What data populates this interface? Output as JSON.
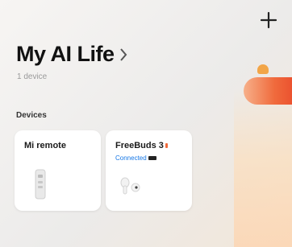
{
  "header": {
    "title": "My AI Life",
    "subtitle": "1 device",
    "add_icon": "plus-icon",
    "chevron_icon": "chevron-right-icon"
  },
  "devices": {
    "section_label": "Devices",
    "items": [
      {
        "name": "Mi remote",
        "status": "",
        "icon": "remote-icon"
      },
      {
        "name": "FreeBuds 3",
        "status": "Connected",
        "icon": "earbuds-icon"
      }
    ]
  },
  "colors": {
    "accent": "#1677e6",
    "banner": "#f06a3c"
  }
}
